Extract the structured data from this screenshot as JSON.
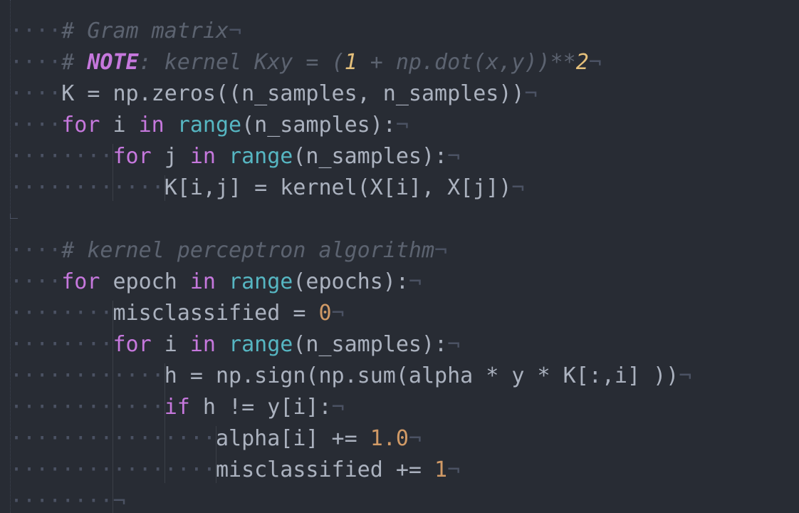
{
  "editor": {
    "theme_colors": {
      "background": "#282c34",
      "comment": "#5c6370",
      "keyword": "#c678dd",
      "builtin": "#56b6c2",
      "number": "#d19a66",
      "plain": "#abb2bf",
      "invisible": "#4b5263"
    },
    "whitespace_glyph": "·",
    "eol_glyph": "¬",
    "lines": [
      {
        "indent": 0,
        "tokens": [],
        "blank": true
      },
      {
        "indent": 1,
        "tokens": [
          {
            "t": "# Gram matrix",
            "k": "comment"
          }
        ]
      },
      {
        "indent": 1,
        "tokens": [
          {
            "t": "# ",
            "k": "comment"
          },
          {
            "t": "NOTE",
            "k": "note"
          },
          {
            "t": ": kernel Kxy = (",
            "k": "comment"
          },
          {
            "t": "1",
            "k": "cnum"
          },
          {
            "t": " + np.dot(x,y))**",
            "k": "comment"
          },
          {
            "t": "2",
            "k": "cnum"
          }
        ]
      },
      {
        "indent": 1,
        "tokens": [
          {
            "t": "K = np.zeros((n_samples, n_samples))",
            "k": "plain"
          }
        ]
      },
      {
        "indent": 1,
        "tokens": [
          {
            "t": "for",
            "k": "keyword"
          },
          {
            "t": " i ",
            "k": "plain"
          },
          {
            "t": "in",
            "k": "keyword"
          },
          {
            "t": " ",
            "k": "plain"
          },
          {
            "t": "range",
            "k": "builtin"
          },
          {
            "t": "(n_samples):",
            "k": "plain"
          }
        ]
      },
      {
        "indent": 2,
        "tokens": [
          {
            "t": "for",
            "k": "keyword"
          },
          {
            "t": " j ",
            "k": "plain"
          },
          {
            "t": "in",
            "k": "keyword"
          },
          {
            "t": " ",
            "k": "plain"
          },
          {
            "t": "range",
            "k": "builtin"
          },
          {
            "t": "(n_samples):",
            "k": "plain"
          }
        ]
      },
      {
        "indent": 3,
        "tokens": [
          {
            "t": "K[i,j] = kernel(X[i], X[j])",
            "k": "plain"
          }
        ]
      },
      {
        "indent": 0,
        "tokens": [],
        "blank": true
      },
      {
        "indent": 1,
        "tokens": [
          {
            "t": "# kernel perceptron algorithm",
            "k": "comment"
          }
        ]
      },
      {
        "indent": 1,
        "tokens": [
          {
            "t": "for",
            "k": "keyword"
          },
          {
            "t": " epoch ",
            "k": "plain"
          },
          {
            "t": "in",
            "k": "keyword"
          },
          {
            "t": " ",
            "k": "plain"
          },
          {
            "t": "range",
            "k": "builtin"
          },
          {
            "t": "(epochs):",
            "k": "plain"
          }
        ]
      },
      {
        "indent": 2,
        "tokens": [
          {
            "t": "misclassified = ",
            "k": "plain"
          },
          {
            "t": "0",
            "k": "number"
          }
        ]
      },
      {
        "indent": 2,
        "tokens": [
          {
            "t": "for",
            "k": "keyword"
          },
          {
            "t": " i ",
            "k": "plain"
          },
          {
            "t": "in",
            "k": "keyword"
          },
          {
            "t": " ",
            "k": "plain"
          },
          {
            "t": "range",
            "k": "builtin"
          },
          {
            "t": "(n_samples):",
            "k": "plain"
          }
        ]
      },
      {
        "indent": 3,
        "tokens": [
          {
            "t": "h = np.sign(np.sum(alpha * y * K[:,i] ))",
            "k": "plain"
          }
        ]
      },
      {
        "indent": 3,
        "tokens": [
          {
            "t": "if",
            "k": "keyword"
          },
          {
            "t": " h != y[i]:",
            "k": "plain"
          }
        ]
      },
      {
        "indent": 4,
        "tokens": [
          {
            "t": "alpha[i] += ",
            "k": "plain"
          },
          {
            "t": "1.0",
            "k": "number"
          }
        ]
      },
      {
        "indent": 4,
        "tokens": [
          {
            "t": "misclassified += ",
            "k": "plain"
          },
          {
            "t": "1",
            "k": "number"
          }
        ]
      },
      {
        "indent": 2,
        "tokens": [],
        "trailing_only": true
      }
    ]
  }
}
